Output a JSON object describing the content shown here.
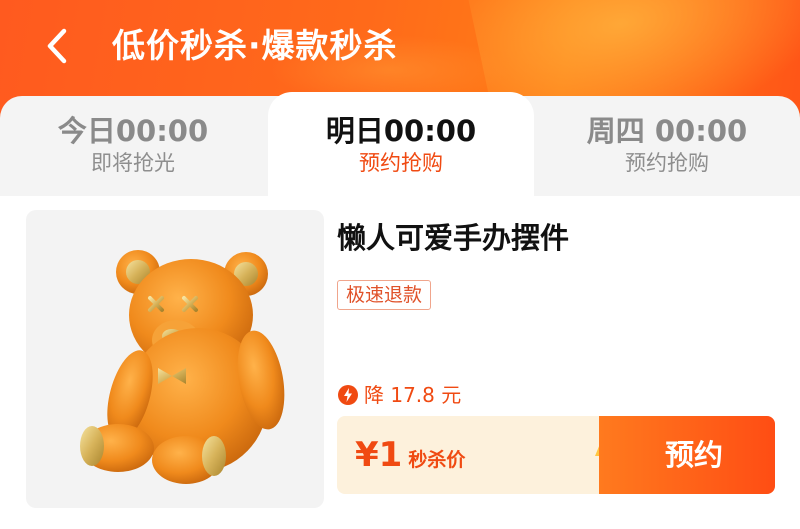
{
  "header": {
    "title": "低价秒杀·爆款秒杀",
    "back_icon": "chevron-left-icon"
  },
  "tabs": [
    {
      "time": "今日00:00",
      "status": "即将抢光",
      "active": false
    },
    {
      "time": "明日00:00",
      "status": "预约抢购",
      "active": true
    },
    {
      "time": "周四 00:00",
      "status": "预约抢购",
      "active": false
    }
  ],
  "product": {
    "name": "懒人可爱手办摆件",
    "badge": "极速退款",
    "price_drop": "降 17.8 元",
    "price": "¥1",
    "price_label": "秒杀价",
    "reserve_label": "预约",
    "image_icon": "bear-figurine-image"
  },
  "colors": {
    "accent": "#f04a12",
    "header_orange": "#ff6a1a",
    "bar_bg": "#fdf1dc"
  }
}
